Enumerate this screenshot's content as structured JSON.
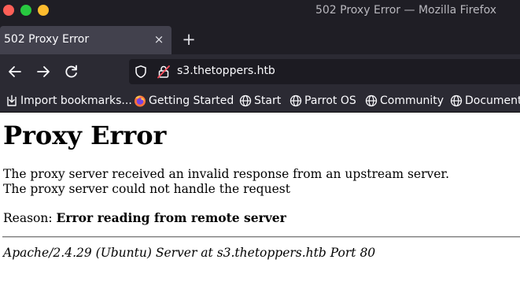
{
  "window": {
    "title": "502 Proxy Error — Mozilla Firefox"
  },
  "tabs": [
    {
      "label": "502 Proxy Error",
      "close": "×"
    }
  ],
  "new_tab": "+",
  "urlbar": {
    "url": "s3.thetoppers.htb"
  },
  "bookmarks": [
    {
      "label": "Import bookmarks...",
      "icon": "import-icon"
    },
    {
      "label": "Getting Started",
      "icon": "firefox-icon"
    },
    {
      "label": "Start",
      "icon": "globe-icon"
    },
    {
      "label": "Parrot OS",
      "icon": "globe-icon"
    },
    {
      "label": "Community",
      "icon": "globe-icon"
    },
    {
      "label": "Documentation",
      "icon": "globe-icon"
    }
  ],
  "page": {
    "heading": "Proxy Error",
    "line1": "The proxy server received an invalid response from an upstream server.",
    "line2": "The proxy server could not handle the request",
    "reason_label": "Reason: ",
    "reason_value": "Error reading from remote server",
    "address": "Apache/2.4.29 (Ubuntu) Server at s3.thetoppers.htb Port 80"
  },
  "colors": {
    "titlebar": "#1f1e25",
    "toolbar": "#2b2a33",
    "active_tab": "#42414d",
    "urlbar": "#1c1b22",
    "close_button": "#fe5f57",
    "minimize_button": "#28c840",
    "maximize_button": "#febc2e"
  }
}
